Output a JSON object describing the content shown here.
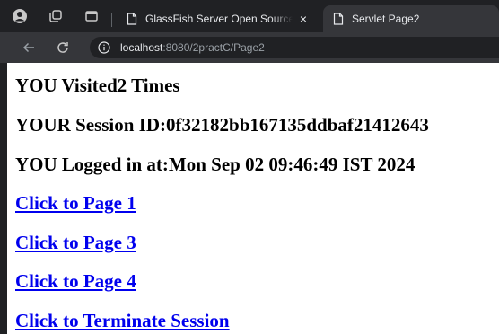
{
  "browser": {
    "tabs": [
      {
        "title": "GlassFish Server Open Source Edition",
        "active": false
      },
      {
        "title": "Servlet Page2",
        "active": true
      }
    ],
    "close_glyph": "×",
    "url_host": "localhost",
    "url_path": ":8080/2practC/Page2"
  },
  "content": {
    "visits": "YOU Visited2 Times",
    "session": "YOUR Session ID:0f32182bb167135ddbaf21412643",
    "login": "YOU Logged in at:Mon Sep 02 09:46:49 IST 2024",
    "links": [
      "Click to Page 1",
      "Click to Page 3",
      "Click to Page 4",
      "Click to Terminate Session"
    ]
  },
  "colors": {
    "link": "#0000ee",
    "chrome_dark": "#202124",
    "chrome_toolbar": "#35363a"
  },
  "icons": [
    "profile-icon",
    "workspaces-icon",
    "tab-actions-icon",
    "page-icon",
    "close-icon",
    "back-icon",
    "reload-icon",
    "info-icon"
  ]
}
